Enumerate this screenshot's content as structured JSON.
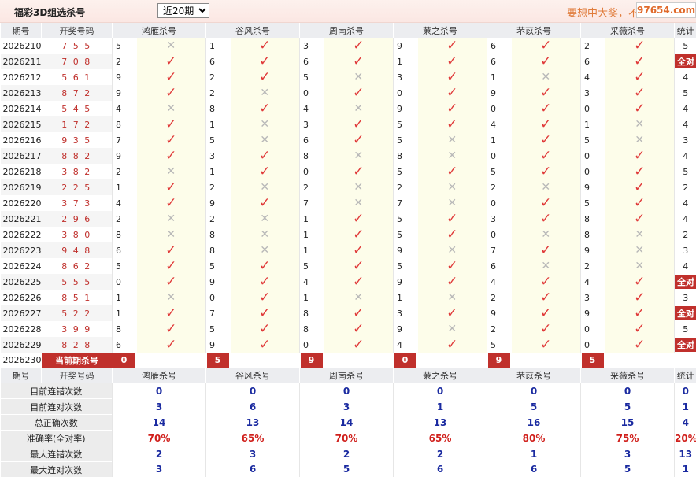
{
  "topbar": {
    "title": "福彩3D组选杀号",
    "period_select": "近20期",
    "slogan": "要想中大奖，不",
    "site_badge": "97654.com"
  },
  "header": {
    "period": "期号",
    "draw": "开奖号码",
    "stat": "统计",
    "experts": [
      "鸿雁杀号",
      "谷风杀号",
      "周南杀号",
      "蒹之杀号",
      "芣苡杀号",
      "采薇杀号"
    ]
  },
  "rows": [
    {
      "p": "2026210",
      "d": "7 5 5",
      "k": [
        [
          "5",
          0
        ],
        [
          "1",
          1
        ],
        [
          "3",
          1
        ],
        [
          "9",
          1
        ],
        [
          "6",
          1
        ],
        [
          "2",
          1
        ]
      ],
      "s": "5"
    },
    {
      "p": "2026211",
      "d": "7 0 8",
      "k": [
        [
          "2",
          1
        ],
        [
          "6",
          1
        ],
        [
          "6",
          1
        ],
        [
          "1",
          1
        ],
        [
          "6",
          1
        ],
        [
          "6",
          1
        ]
      ],
      "s": "全对"
    },
    {
      "p": "2026212",
      "d": "5 6 1",
      "k": [
        [
          "9",
          1
        ],
        [
          "2",
          1
        ],
        [
          "5",
          0
        ],
        [
          "3",
          1
        ],
        [
          "1",
          0
        ],
        [
          "4",
          1
        ]
      ],
      "s": "4"
    },
    {
      "p": "2026213",
      "d": "8 7 2",
      "k": [
        [
          "9",
          1
        ],
        [
          "2",
          0
        ],
        [
          "0",
          1
        ],
        [
          "0",
          1
        ],
        [
          "9",
          1
        ],
        [
          "3",
          1
        ]
      ],
      "s": "5"
    },
    {
      "p": "2026214",
      "d": "5 4 5",
      "k": [
        [
          "4",
          0
        ],
        [
          "8",
          1
        ],
        [
          "4",
          0
        ],
        [
          "9",
          1
        ],
        [
          "0",
          1
        ],
        [
          "0",
          1
        ]
      ],
      "s": "4"
    },
    {
      "p": "2026215",
      "d": "1 7 2",
      "k": [
        [
          "8",
          1
        ],
        [
          "1",
          0
        ],
        [
          "3",
          1
        ],
        [
          "5",
          1
        ],
        [
          "4",
          1
        ],
        [
          "1",
          0
        ]
      ],
      "s": "4"
    },
    {
      "p": "2026216",
      "d": "9 3 5",
      "k": [
        [
          "7",
          1
        ],
        [
          "5",
          0
        ],
        [
          "6",
          1
        ],
        [
          "5",
          0
        ],
        [
          "1",
          1
        ],
        [
          "5",
          0
        ]
      ],
      "s": "3"
    },
    {
      "p": "2026217",
      "d": "8 8 2",
      "k": [
        [
          "9",
          1
        ],
        [
          "3",
          1
        ],
        [
          "8",
          0
        ],
        [
          "8",
          0
        ],
        [
          "0",
          1
        ],
        [
          "0",
          1
        ]
      ],
      "s": "4"
    },
    {
      "p": "2026218",
      "d": "3 8 2",
      "k": [
        [
          "2",
          0
        ],
        [
          "1",
          1
        ],
        [
          "0",
          1
        ],
        [
          "5",
          1
        ],
        [
          "5",
          1
        ],
        [
          "0",
          1
        ]
      ],
      "s": "5"
    },
    {
      "p": "2026219",
      "d": "2 2 5",
      "k": [
        [
          "1",
          1
        ],
        [
          "2",
          0
        ],
        [
          "2",
          0
        ],
        [
          "2",
          0
        ],
        [
          "2",
          0
        ],
        [
          "9",
          1
        ]
      ],
      "s": "2"
    },
    {
      "p": "2026220",
      "d": "3 7 3",
      "k": [
        [
          "4",
          1
        ],
        [
          "9",
          1
        ],
        [
          "7",
          0
        ],
        [
          "7",
          0
        ],
        [
          "0",
          1
        ],
        [
          "5",
          1
        ]
      ],
      "s": "4"
    },
    {
      "p": "2026221",
      "d": "2 9 6",
      "k": [
        [
          "2",
          0
        ],
        [
          "2",
          0
        ],
        [
          "1",
          1
        ],
        [
          "5",
          1
        ],
        [
          "3",
          1
        ],
        [
          "8",
          1
        ]
      ],
      "s": "4"
    },
    {
      "p": "2026222",
      "d": "3 8 0",
      "k": [
        [
          "8",
          0
        ],
        [
          "8",
          0
        ],
        [
          "1",
          1
        ],
        [
          "5",
          1
        ],
        [
          "0",
          0
        ],
        [
          "8",
          0
        ]
      ],
      "s": "2"
    },
    {
      "p": "2026223",
      "d": "9 4 8",
      "k": [
        [
          "6",
          1
        ],
        [
          "8",
          0
        ],
        [
          "1",
          1
        ],
        [
          "9",
          0
        ],
        [
          "7",
          1
        ],
        [
          "9",
          0
        ]
      ],
      "s": "3"
    },
    {
      "p": "2026224",
      "d": "8 6 2",
      "k": [
        [
          "5",
          1
        ],
        [
          "5",
          1
        ],
        [
          "5",
          1
        ],
        [
          "5",
          1
        ],
        [
          "6",
          0
        ],
        [
          "2",
          0
        ]
      ],
      "s": "4"
    },
    {
      "p": "2026225",
      "d": "5 5 5",
      "k": [
        [
          "0",
          1
        ],
        [
          "9",
          1
        ],
        [
          "4",
          1
        ],
        [
          "9",
          1
        ],
        [
          "4",
          1
        ],
        [
          "4",
          1
        ]
      ],
      "s": "全对"
    },
    {
      "p": "2026226",
      "d": "8 5 1",
      "k": [
        [
          "1",
          0
        ],
        [
          "0",
          1
        ],
        [
          "1",
          0
        ],
        [
          "1",
          0
        ],
        [
          "2",
          1
        ],
        [
          "3",
          1
        ]
      ],
      "s": "3"
    },
    {
      "p": "2026227",
      "d": "5 2 2",
      "k": [
        [
          "1",
          1
        ],
        [
          "7",
          1
        ],
        [
          "8",
          1
        ],
        [
          "3",
          1
        ],
        [
          "9",
          1
        ],
        [
          "9",
          1
        ]
      ],
      "s": "全对"
    },
    {
      "p": "2026228",
      "d": "3 9 9",
      "k": [
        [
          "8",
          1
        ],
        [
          "5",
          1
        ],
        [
          "8",
          1
        ],
        [
          "9",
          0
        ],
        [
          "2",
          1
        ],
        [
          "0",
          1
        ]
      ],
      "s": "5"
    },
    {
      "p": "2026229",
      "d": "8 2 8",
      "k": [
        [
          "6",
          1
        ],
        [
          "9",
          1
        ],
        [
          "0",
          1
        ],
        [
          "4",
          1
        ],
        [
          "5",
          1
        ],
        [
          "0",
          1
        ]
      ],
      "s": "全对"
    }
  ],
  "current": {
    "period": "2026230",
    "label": "当前期杀号",
    "kills": [
      "0",
      "5",
      "9",
      "0",
      "9",
      "5"
    ]
  },
  "stats": [
    {
      "label": "目前连错次数",
      "v": [
        "0",
        "0",
        "0",
        "0",
        "0",
        "0",
        "0"
      ],
      "red": false
    },
    {
      "label": "目前连对次数",
      "v": [
        "3",
        "6",
        "3",
        "1",
        "5",
        "5",
        "1"
      ],
      "red": false
    },
    {
      "label": "总正确次数",
      "v": [
        "14",
        "13",
        "14",
        "13",
        "16",
        "15",
        "4"
      ],
      "red": false
    },
    {
      "label": "准确率(全对率)",
      "v": [
        "70%",
        "65%",
        "70%",
        "65%",
        "80%",
        "75%",
        "20%"
      ],
      "red": true
    },
    {
      "label": "最大连错次数",
      "v": [
        "2",
        "3",
        "2",
        "2",
        "1",
        "3",
        "13"
      ],
      "red": false
    },
    {
      "label": "最大连对次数",
      "v": [
        "3",
        "6",
        "5",
        "6",
        "6",
        "5",
        "1"
      ],
      "red": false
    }
  ]
}
